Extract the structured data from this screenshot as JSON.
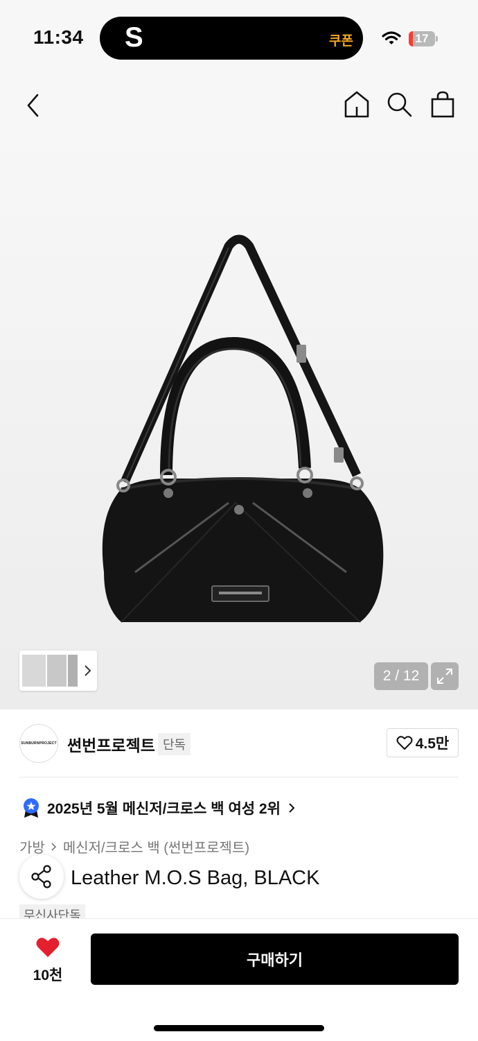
{
  "status_bar": {
    "time": "11:34",
    "island_logo": "S",
    "coupon_label": "쿠폰",
    "battery_level": "17"
  },
  "nav": {
    "back_icon": "chevron-left-icon",
    "home_icon": "home-icon",
    "search_icon": "search-icon",
    "cart_icon": "bag-icon"
  },
  "gallery": {
    "counter": "2 / 12"
  },
  "brand": {
    "logo_text": "SUNBURNPROJECT",
    "name": "썬번프로젝트",
    "exclusive_tag": "단독",
    "likes": "4.5만"
  },
  "ranking": {
    "text": "2025년 5월 메신저/크로스 백 여성 2위"
  },
  "breadcrumb": {
    "category": "가방",
    "subcategory": "메신저/크로스 백 (썬번프로젝트)"
  },
  "product": {
    "title": "Leather M.O.S Bag, BLACK",
    "badge": "무신사단독"
  },
  "bottom_bar": {
    "wish_count": "10천",
    "buy_label": "구매하기"
  },
  "colors": {
    "accent": "#000000",
    "heart": "#e5202e",
    "coupon": "#f5a623"
  }
}
